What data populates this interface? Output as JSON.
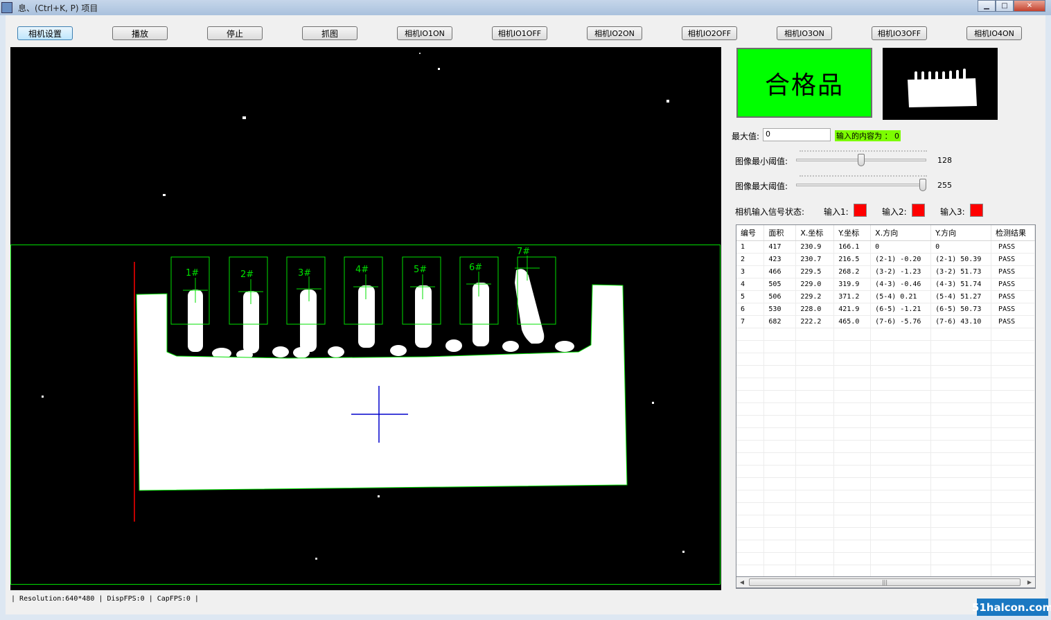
{
  "window": {
    "title": "息、(Ctrl+K, P) 项目"
  },
  "toolbar": {
    "buttons": [
      "相机设置",
      "播放",
      "停止",
      "抓图",
      "相机IO1ON",
      "相机IO1OFF",
      "相机IO2ON",
      "相机IO2OFF",
      "相机IO3ON",
      "相机IO3OFF",
      "相机IO4ON"
    ]
  },
  "result": {
    "status_text": "合格品",
    "status_color": "#00ff00"
  },
  "max_value": {
    "label": "最大值:",
    "value": "0",
    "feedback": "输入的内容为 ： 0"
  },
  "threshold": {
    "min_label": "图像最小阈值:",
    "min_value": "128",
    "max_label": "图像最大阈值:",
    "max_value": "255",
    "range": [
      0,
      255
    ]
  },
  "inputs": {
    "label": "相机输入信号状态:",
    "items": [
      {
        "label": "输入1:",
        "color": "#ff0000"
      },
      {
        "label": "输入2:",
        "color": "#ff0000"
      },
      {
        "label": "输入3:",
        "color": "#ff0000"
      }
    ]
  },
  "image_view": {
    "region_labels": [
      "1#",
      "2#",
      "3#",
      "4#",
      "5#",
      "6#",
      "7#"
    ],
    "roi_color": "#00e000",
    "edge_line_color": "#ff0000",
    "center_cross_color": "#0000ff"
  },
  "table": {
    "headers": [
      "编号",
      "面积",
      "X.坐标",
      "Y.坐标",
      "X.方向",
      "Y.方向",
      "检测结果"
    ],
    "rows": [
      [
        "1",
        "417",
        "230.9",
        "166.1",
        "0",
        "0",
        "PASS"
      ],
      [
        "2",
        "423",
        "230.7",
        "216.5",
        "(2-1) -0.20",
        "(2-1) 50.39",
        "PASS"
      ],
      [
        "3",
        "466",
        "229.5",
        "268.2",
        "(3-2) -1.23",
        "(3-2) 51.73",
        "PASS"
      ],
      [
        "4",
        "505",
        "229.0",
        "319.9",
        "(4-3) -0.46",
        "(4-3) 51.74",
        "PASS"
      ],
      [
        "5",
        "506",
        "229.2",
        "371.2",
        "(5-4) 0.21",
        "(5-4) 51.27",
        "PASS"
      ],
      [
        "6",
        "530",
        "228.0",
        "421.9",
        "(6-5) -1.21",
        "(6-5) 50.73",
        "PASS"
      ],
      [
        "7",
        "682",
        "222.2",
        "465.0",
        "(7-6) -5.76",
        "(7-6) 43.10",
        "PASS"
      ]
    ]
  },
  "statusbar": {
    "resolution": "Resolution:640*480",
    "disp_fps": "DispFPS:0",
    "cap_fps": "CapFPS:0"
  },
  "watermark": "51halcon.com"
}
